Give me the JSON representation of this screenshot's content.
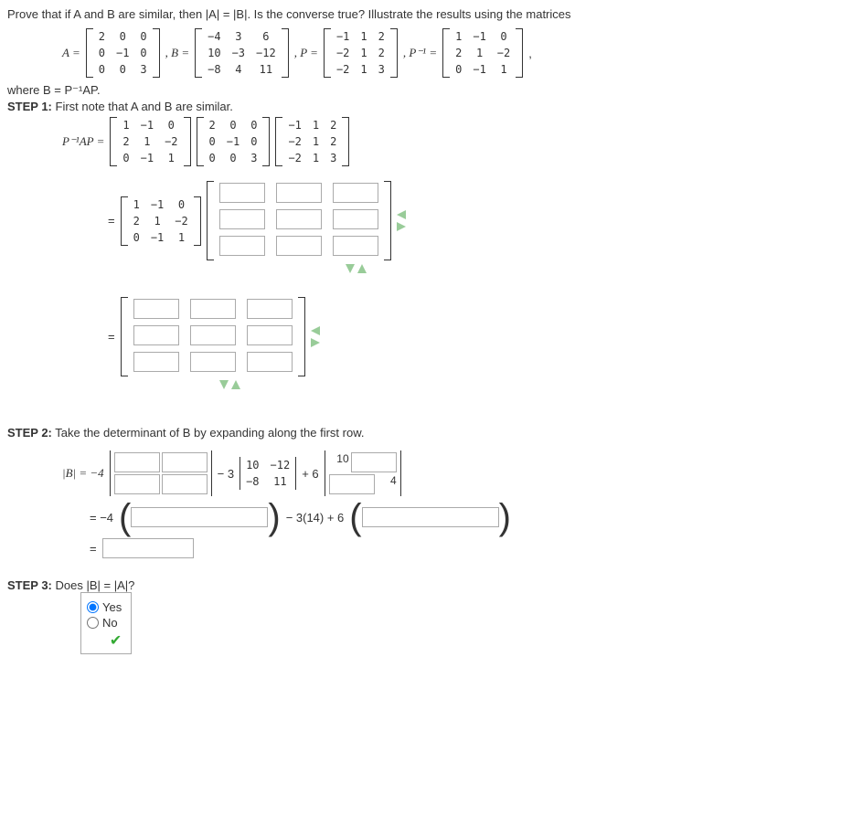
{
  "intro": "Prove that if A and B are similar, then |A| = |B|. Is the converse true? Illustrate the results using the matrices",
  "A_lhs": "A =",
  "A": [
    [
      "2",
      "0",
      "0"
    ],
    [
      "0",
      "−1",
      "0"
    ],
    [
      "0",
      "0",
      "3"
    ]
  ],
  "B_lhs": ", B =",
  "B": [
    [
      "−4",
      "3",
      "6"
    ],
    [
      "10",
      "−3",
      "−12"
    ],
    [
      "−8",
      "4",
      "11"
    ]
  ],
  "P_lhs": ", P =",
  "P": [
    [
      "−1",
      "1",
      "2"
    ],
    [
      "−2",
      "1",
      "2"
    ],
    [
      "−2",
      "1",
      "3"
    ]
  ],
  "Pi_lhs": ", P⁻¹ =",
  "Pi": [
    [
      "1",
      "−1",
      "0"
    ],
    [
      "2",
      "1",
      "−2"
    ],
    [
      "0",
      "−1",
      "1"
    ]
  ],
  "tail": ",",
  "where": "where B = P⁻¹AP.",
  "step1_label": "STEP 1:",
  "step1_text": " First note that A and B are similar.",
  "PiAP_lhs": "P⁻¹AP =",
  "M1": [
    [
      "1",
      "−1",
      "0"
    ],
    [
      "2",
      "1",
      "−2"
    ],
    [
      "0",
      "−1",
      "1"
    ]
  ],
  "M2": [
    [
      "2",
      "0",
      "0"
    ],
    [
      "0",
      "−1",
      "0"
    ],
    [
      "0",
      "0",
      "3"
    ]
  ],
  "M3": [
    [
      "−1",
      "1",
      "2"
    ],
    [
      "−2",
      "1",
      "2"
    ],
    [
      "−2",
      "1",
      "3"
    ]
  ],
  "eq": "=",
  "step2_label": "STEP 2:",
  "step2_text": " Take the determinant of B by expanding along the first row.",
  "detB_lhs": "|B| = −4",
  "m3": "− 3",
  "minor2": [
    [
      "10",
      "−12"
    ],
    [
      "−8",
      "11"
    ]
  ],
  "p6": "+ 6",
  "ten": "10",
  "four": "4",
  "line2_a": "= −4",
  "line2_b": " − 3(14) + 6",
  "step3_label": "STEP 3:",
  "step3_text": " Does |B| = |A|?",
  "yes": "Yes",
  "no": "No"
}
